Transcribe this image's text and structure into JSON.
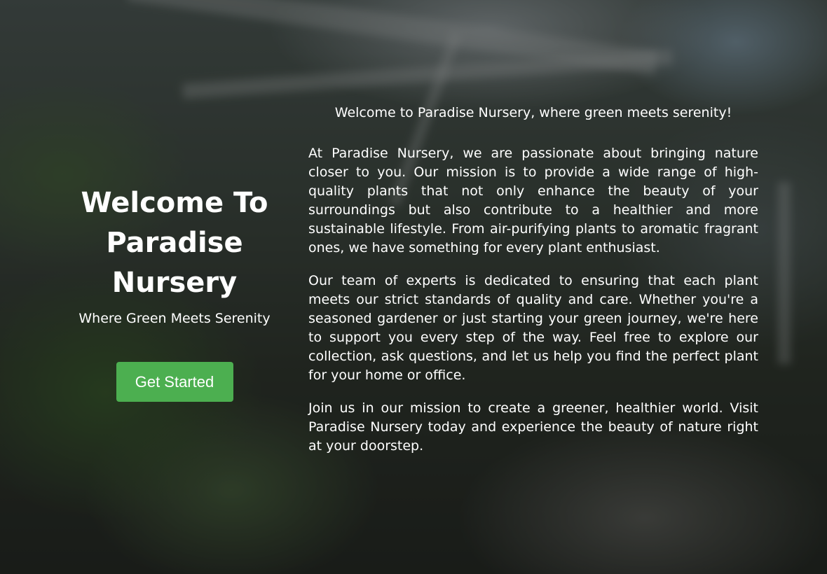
{
  "hero": {
    "title": "Welcome To Paradise Nursery",
    "subtitle": "Where Green Meets Serenity",
    "cta_label": "Get Started"
  },
  "about": {
    "tagline": "Welcome to Paradise Nursery, where green meets serenity!",
    "paragraphs": [
      "At Paradise Nursery, we are passionate about bringing nature closer to you. Our mission is to provide a wide range of high-quality plants that not only enhance the beauty of your surroundings but also contribute to a healthier and more sustainable lifestyle. From air-purifying plants to aromatic fragrant ones, we have something for every plant enthusiast.",
      "Our team of experts is dedicated to ensuring that each plant meets our strict standards of quality and care. Whether you're a seasoned gardener or just starting your green journey, we're here to support you every step of the way. Feel free to explore our collection, ask questions, and let us help you find the perfect plant for your home or office.",
      "Join us in our mission to create a greener, healthier world. Visit Paradise Nursery today and experience the beauty of nature right at your doorstep."
    ]
  },
  "colors": {
    "cta_background": "#4caf50",
    "text": "#ffffff",
    "overlay": "rgba(0,0,0,0.45)"
  }
}
